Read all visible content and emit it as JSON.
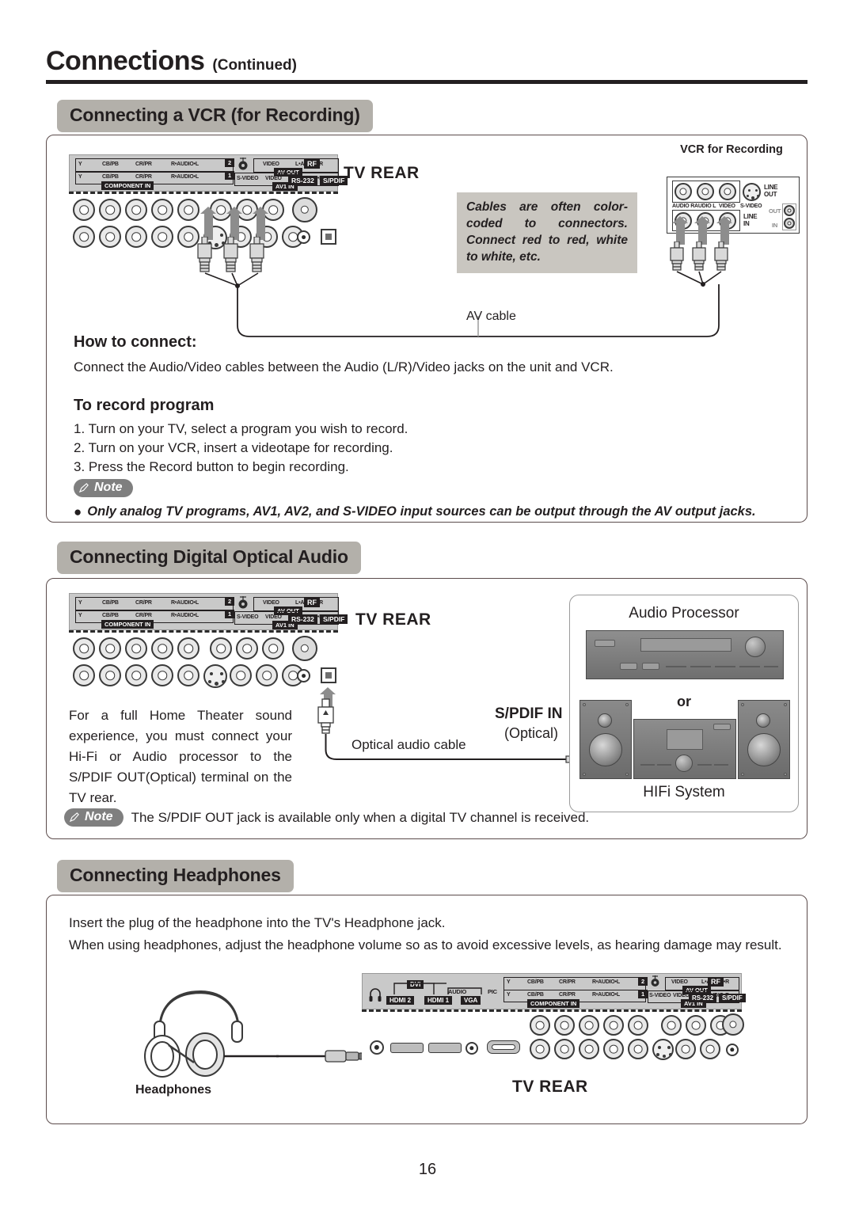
{
  "header": {
    "title": "Connections",
    "continued": "(Continued)"
  },
  "sections": {
    "vcr": {
      "chip": "Connecting a VCR (for Recording)",
      "tv_rear_label": "TV REAR",
      "vcr_title": "VCR for Recording",
      "callout": "Cables are often color-coded to connectors. Connect red to red, white to white, etc.",
      "av_cable_label": "AV cable",
      "how_to_connect_title": "How to connect:",
      "how_to_connect_text": "Connect the Audio/Video cables between the Audio (L/R)/Video jacks on the unit and VCR.",
      "record_title": "To record program",
      "steps": [
        "1. Turn on your TV, select a program you wish to record.",
        "2. Turn on your VCR, insert a videotape for recording.",
        "3. Press the Record button to begin recording."
      ],
      "note_badge": "Note",
      "note_text": "Only analog TV programs, AV1, AV2, and S-VIDEO input sources can be output through the AV output jacks.",
      "vcr_panel": {
        "row1_labels": [
          "AUDIO R",
          "AUDIO L",
          "VIDEO",
          "S-VIDEO"
        ],
        "line_out": "LINE\nOUT",
        "line_out_l1": "LINE",
        "line_out_l2": "OUT",
        "line_in_l1": "LINE",
        "line_in_l2": "IN",
        "rf_out": "OUT",
        "rf_in": "IN"
      }
    },
    "optical": {
      "chip": "Connecting Digital Optical Audio",
      "tv_rear_label": "TV REAR",
      "paragraph": "For a full Home Theater sound experience, you must connect your Hi-Fi or Audio processor to the S/PDIF OUT(Optical) terminal on the TV rear.",
      "optical_cable_label": "Optical audio cable",
      "spdif_in_l1": "S/PDIF IN",
      "spdif_in_l2": "(Optical)",
      "audio_processor_label": "Audio Processor",
      "or_label": "or",
      "hifi_label": "HIFi System",
      "note_badge": "Note",
      "note_text": "The S/PDIF OUT jack is available only when a digital TV channel is received."
    },
    "headphones": {
      "chip": "Connecting Headphones",
      "line1": "Insert the plug of the headphone into the TV's Headphone jack.",
      "line2": "When using headphones, adjust the headphone volume so as to avoid excessive levels, as hearing damage may result.",
      "headphones_label": "Headphones",
      "tv_rear_label": "TV REAR"
    }
  },
  "tv_panel_labels": {
    "y": "Y",
    "cb_pb": "CB/PB",
    "cr_pr": "CR/PR",
    "audio_lr": "R•AUDIO•L",
    "num2": "2",
    "num1": "1",
    "component_in": "COMPONENT IN",
    "video": "VIDEO",
    "audio_rl": "L•AUDIO•R",
    "av_out": "AV OUT",
    "s_video": "S-VIDEO",
    "av1_in": "AV1 IN",
    "rf": "RF",
    "rs232": "RS-232",
    "spdif": "S/PDIF",
    "hdmi2": "HDMI 2",
    "hdmi1": "HDMI 1",
    "dvi": "DVI",
    "audio": "AUDIO",
    "vga": "VGA",
    "pic": "PIC"
  },
  "page_number": "16",
  "colors": {
    "chip_bg": "#b3b0aa",
    "callout_bg": "#c9c6c0",
    "note_bg": "#7f7f7f",
    "panel_bg": "#c9c9c9",
    "ink": "#231f20",
    "arrow": "#8d8d8d",
    "box_border": "#5b4b4b"
  }
}
